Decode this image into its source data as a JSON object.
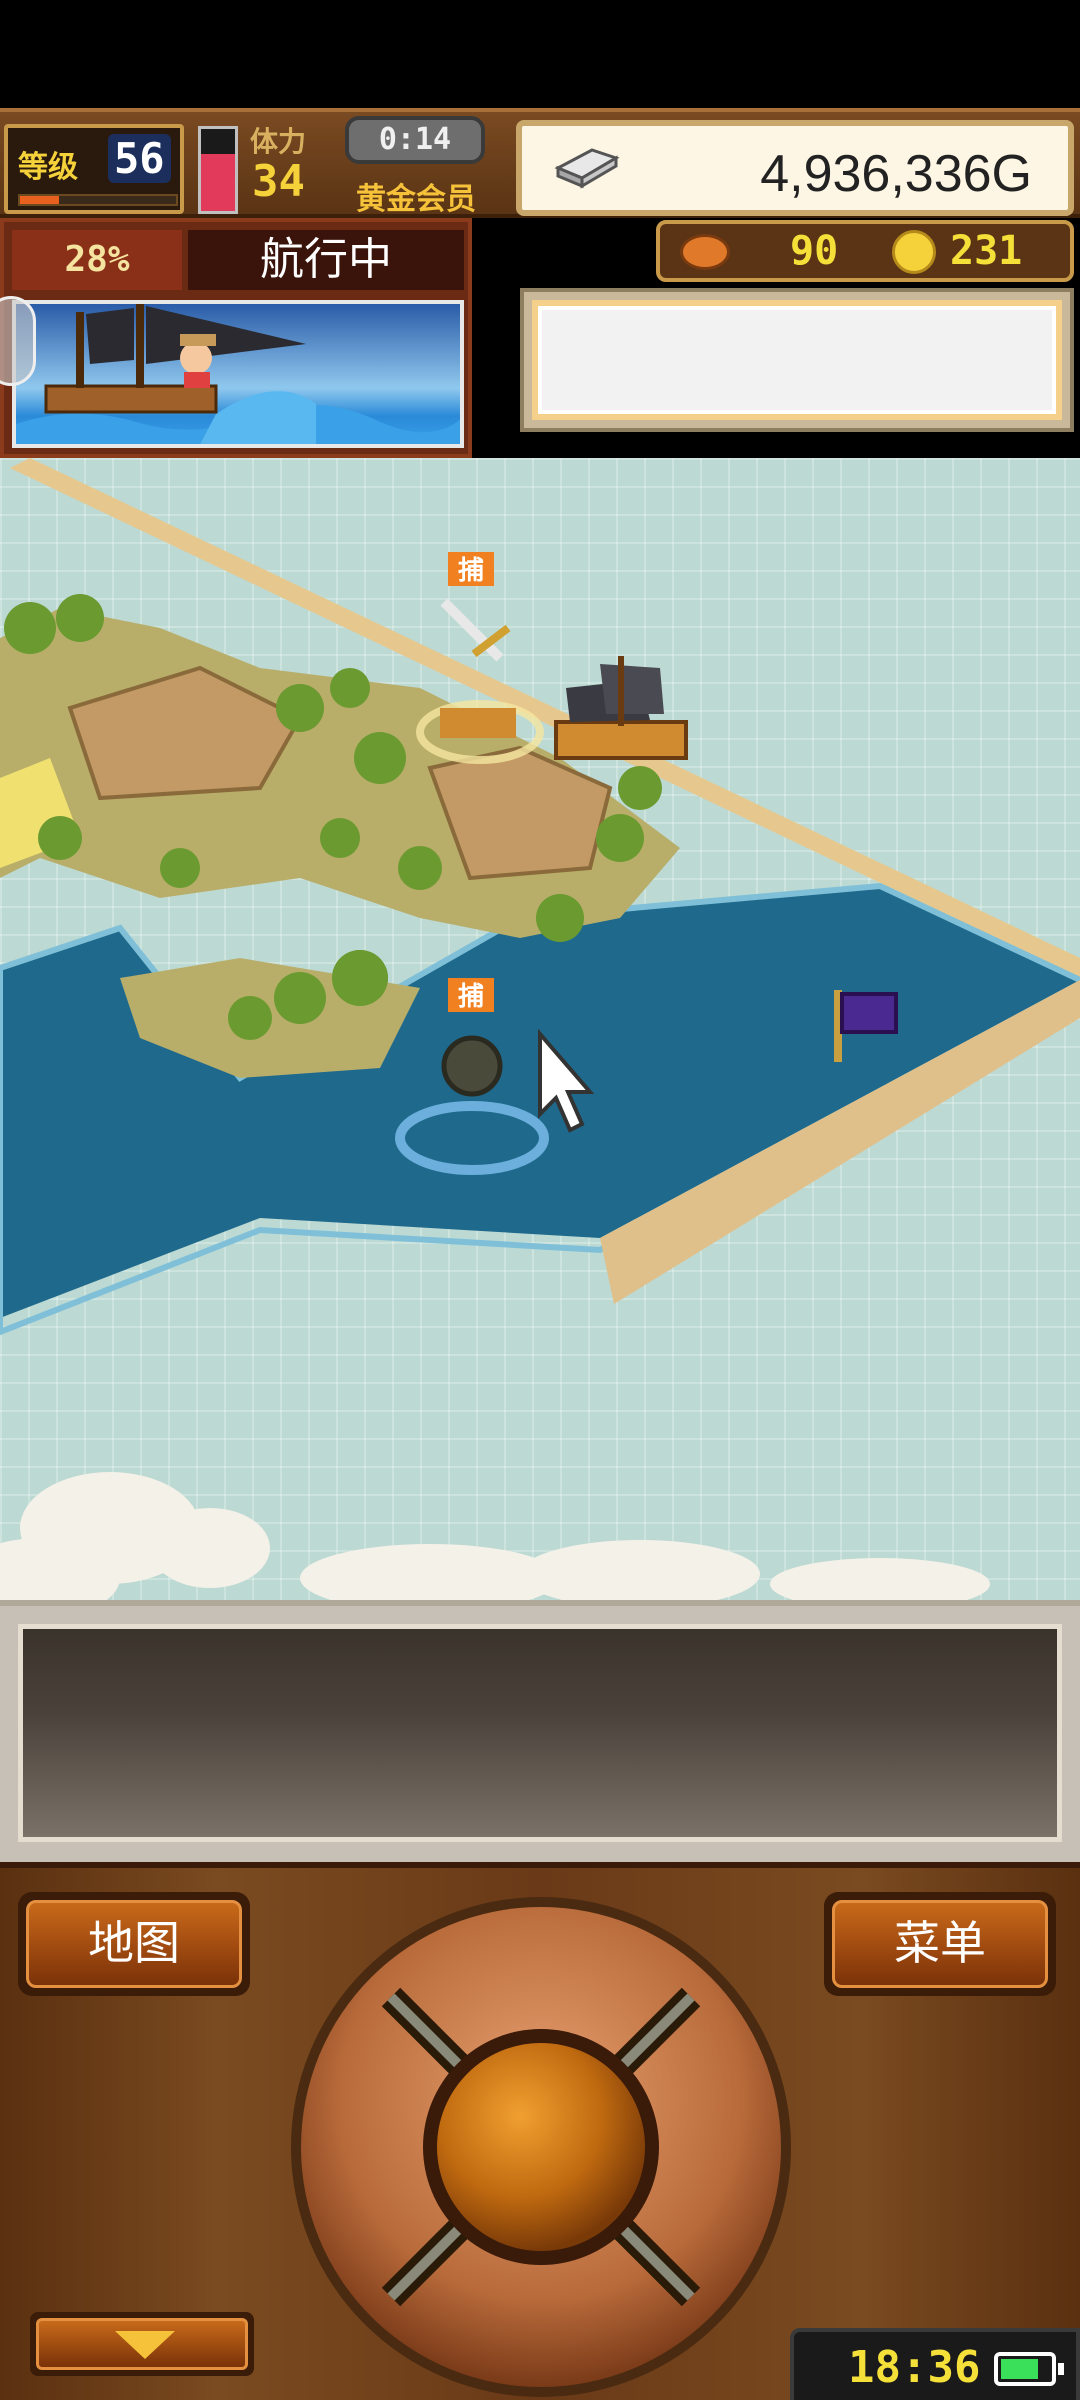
{
  "hud": {
    "level_label": "等级",
    "level": "56",
    "exp_fraction": 0.25,
    "stamina_label": "体力",
    "stamina": "34",
    "stamina_fraction": 0.7,
    "timer": "0:14",
    "member_label": "黄金会员",
    "money": "4,936,336G",
    "food": "90",
    "coins": "231"
  },
  "voyage": {
    "progress": "28%",
    "status": "航行中"
  },
  "map": {
    "marker_1": "捕",
    "marker_2": "捕"
  },
  "controls": {
    "map_label": "地图",
    "menu_label": "菜单"
  },
  "status": {
    "clock": "18:36",
    "battery_fraction": 0.8
  },
  "colors": {
    "sea": "#1f6a8c",
    "sky_map": "#bcd9d3",
    "wood": "#7a4a20",
    "gold_text": "#f5e03a"
  }
}
